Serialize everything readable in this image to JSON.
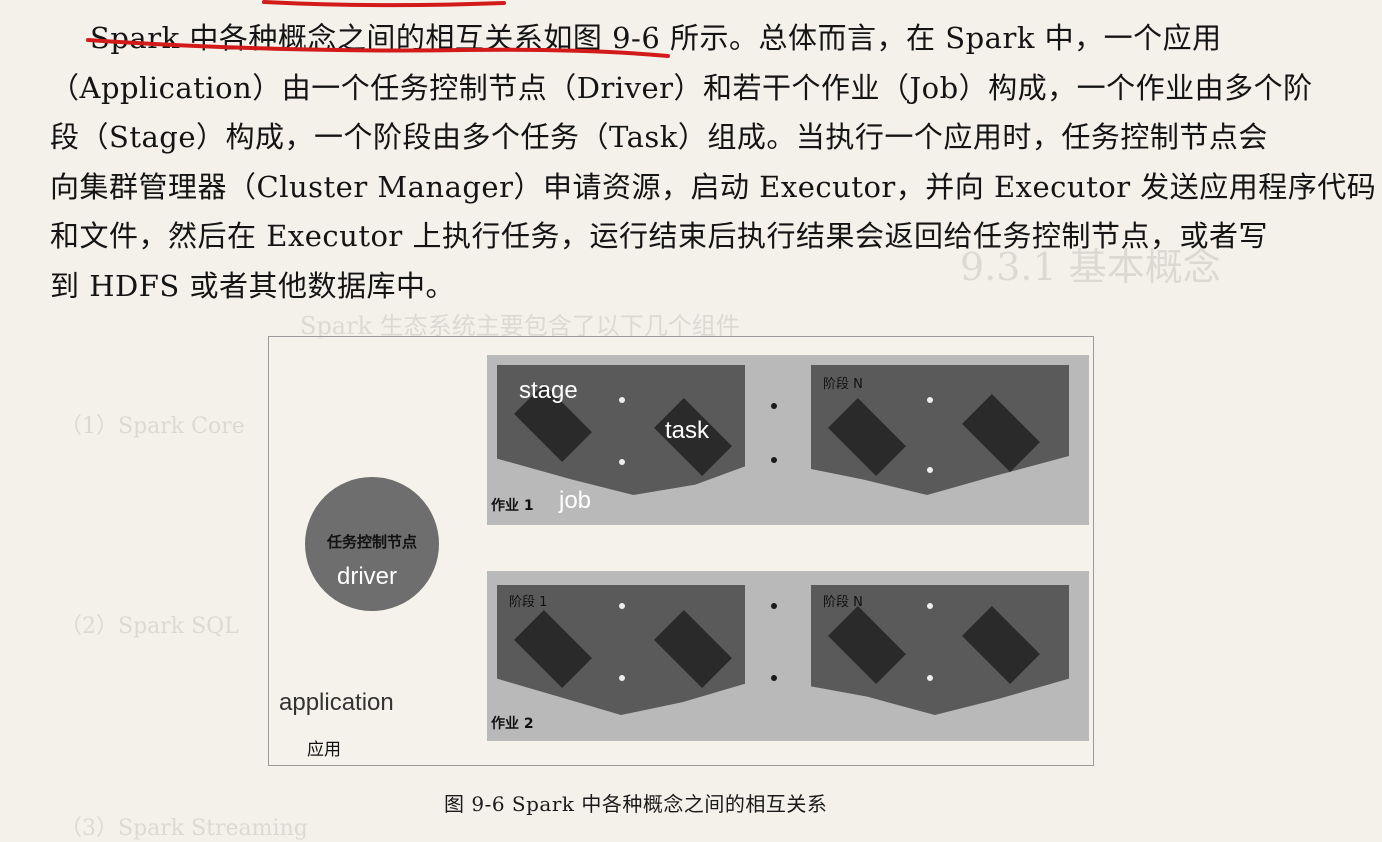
{
  "paragraph": {
    "lines": [
      "Spark 中各种概念之间的相互关系如图 9-6 所示。总体而言，在 Spark 中，一个应用",
      "（Application）由一个任务控制节点（Driver）和若干个作业（Job）构成，一个作业由多个阶",
      "段（Stage）构成，一个阶段由多个任务（Task）组成。当执行一个应用时，任务控制节点会",
      "向集群管理器（Cluster Manager）申请资源，启动 Executor，并向 Executor 发送应用程序代码",
      "和文件，然后在 Executor 上执行任务，运行结束后执行结果会返回给任务控制节点，或者写",
      "到 HDFS 或者其他数据库中。"
    ],
    "underline_color": "#d21a1a"
  },
  "figure": {
    "job1_label": "作业 1",
    "job2_label": "作业 2",
    "stage_first_label": "阶段 1",
    "stage_n_label": "阶段 N",
    "driver_label": "任务控制节点",
    "application_label": "应用",
    "overlay": {
      "stage": "stage",
      "task": "task",
      "job": "job",
      "driver": "driver",
      "application": "application"
    }
  },
  "caption": "图 9-6   Spark 中各种概念之间的相互关系",
  "bleed_through": {
    "lines": [
      "9.3.1  基本概念",
      "Spark 生态系统主要包含了以下几个组件",
      "（1）Spark Core",
      "（2）Spark SQL",
      "（3）Spark Streaming"
    ]
  },
  "colors": {
    "paper": "#f4f1ea",
    "job_background": "#b9b9b9",
    "stage_background": "#5a5a5a",
    "driver_circle": "#6e6e6e"
  }
}
